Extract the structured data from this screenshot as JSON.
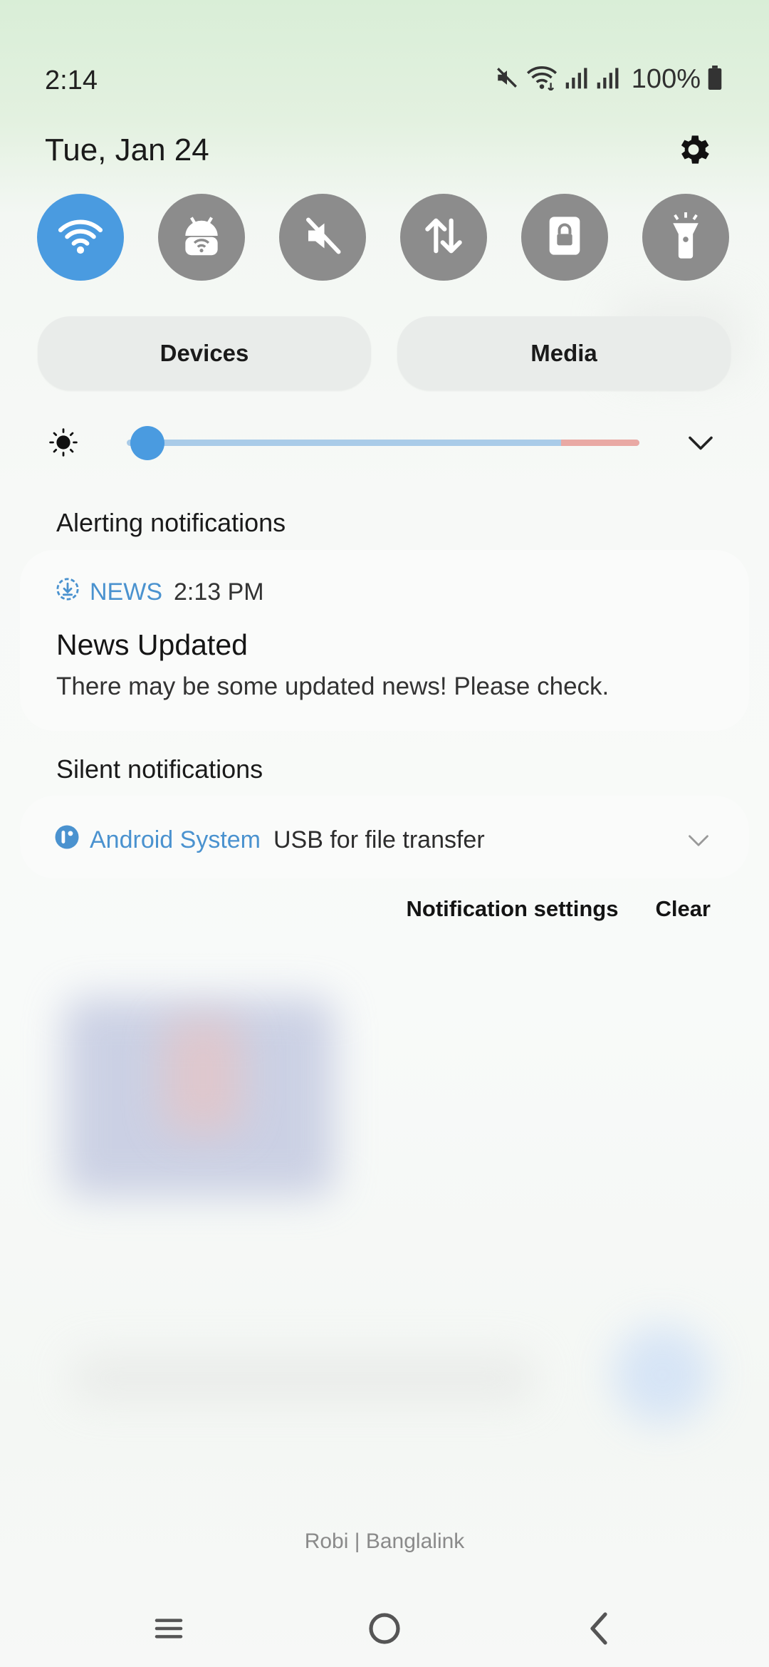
{
  "status_bar": {
    "time": "2:14",
    "battery_text": "100%",
    "icons": [
      "mute-icon",
      "wifi-icon",
      "signal-icon",
      "signal-icon",
      "battery-icon"
    ]
  },
  "header": {
    "date": "Tue, Jan 24",
    "settings_icon": "gear-icon"
  },
  "quick_settings": {
    "tiles": [
      {
        "name": "wifi",
        "icon": "wifi-icon",
        "active": true
      },
      {
        "name": "hotspot",
        "icon": "android-hotspot-icon",
        "active": false
      },
      {
        "name": "sound",
        "icon": "mute-icon",
        "active": false
      },
      {
        "name": "mobile-data",
        "icon": "data-transfer-icon",
        "active": false
      },
      {
        "name": "secure-folder",
        "icon": "lock-icon",
        "active": false
      },
      {
        "name": "flashlight",
        "icon": "flashlight-icon",
        "active": false
      }
    ],
    "accent_color": "#4a9be0",
    "inactive_color": "#8c8c8c"
  },
  "buttons": {
    "devices": "Devices",
    "media": "Media"
  },
  "brightness": {
    "level": 0.04
  },
  "alerting": {
    "label": "Alerting notifications",
    "notification": {
      "app": "NEWS",
      "time": "2:13 PM",
      "title": "News Updated",
      "body": "There may be some updated news! Please check."
    }
  },
  "silent": {
    "label": "Silent notifications",
    "notification": {
      "app": "Android System",
      "text": "USB for file transfer"
    }
  },
  "footer": {
    "notification_settings": "Notification settings",
    "clear": "Clear"
  },
  "carrier": "Robi | Banglalink"
}
